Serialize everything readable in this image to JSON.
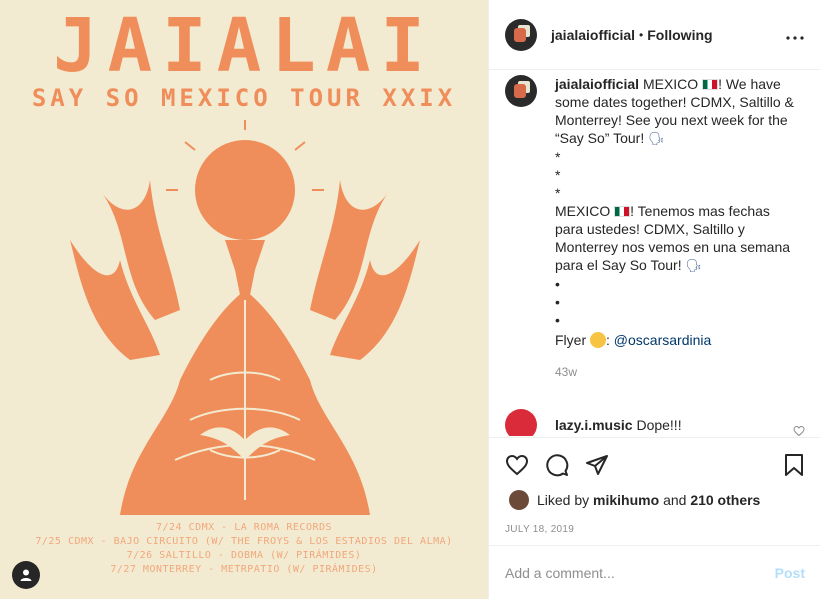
{
  "poster": {
    "title": "JAIALAI",
    "subtitle": "SAY SO MEXICO TOUR XXIX",
    "dates": [
      "7/24 CDMX - LA ROMA RECORDS",
      "7/25 CDMX - BAJO CIRCUITO (W/ THE FROYS & LOS ESTADIOS DEL ALMA)",
      "7/26 SALTILLO - DOBMA (W/ PIRÁMIDES)",
      "7/27 MONTERREY - METRPATIO (W/ PIRÁMIDES)"
    ],
    "colors": {
      "background": "#f3ebd1",
      "accent": "#ef8e5a"
    }
  },
  "header": {
    "username": "jaialaiofficial",
    "separator": "•",
    "follow_status": "Following",
    "more_icon": "more-horizontal-icon"
  },
  "caption": {
    "username": "jaialaiofficial",
    "part1": "MEXICO",
    "part1_rest": "! We have some dates together! CDMX, Saltillo & Monterrey! See you next week for the “Say So” Tour!",
    "bullets1": [
      "*",
      "*",
      "*"
    ],
    "part2": "MEXICO",
    "part2_rest": "! Tenemos mas fechas para ustedes! CDMX, Saltillo y Monterrey nos vemos en una semana para el Say So Tour!",
    "bullets2": [
      "•",
      "•",
      "•"
    ],
    "flyer_label": "Flyer",
    "flyer_mention": "@oscarsardinia",
    "age": "43w"
  },
  "comment": {
    "username": "lazy.i.music",
    "text": "Dope!!!"
  },
  "likes": {
    "prefix": "Liked by",
    "user": "mikihumo",
    "conjunction": "and",
    "others": "210 others"
  },
  "date": "JULY 18, 2019",
  "add_comment": {
    "placeholder": "Add a comment...",
    "post_label": "Post"
  }
}
